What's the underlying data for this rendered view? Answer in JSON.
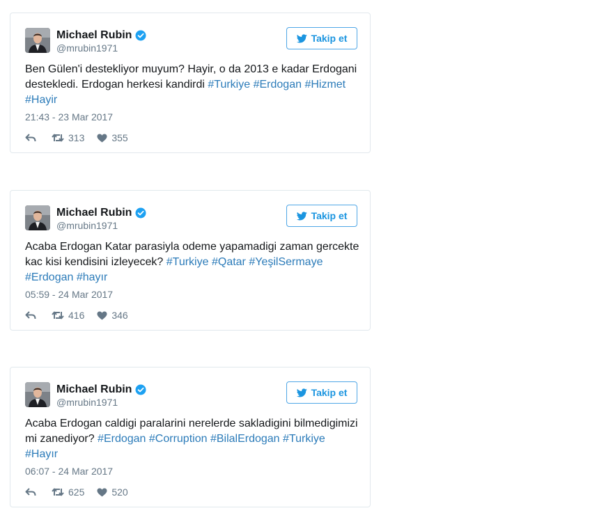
{
  "tweets": [
    {
      "author_name": "Michael Rubin",
      "author_handle": "@mrubin1971",
      "follow_label": "Takip et",
      "text_segments": [
        {
          "type": "text",
          "value": "Ben Gülen'i destekliyor muyum? Hayir, o da 2013 e kadar Erdogani destekledi. Erdogan herkesi kandirdi "
        },
        {
          "type": "hashtag",
          "value": "#Turkiye"
        },
        {
          "type": "text",
          "value": " "
        },
        {
          "type": "hashtag",
          "value": "#Erdogan"
        },
        {
          "type": "text",
          "value": " "
        },
        {
          "type": "hashtag",
          "value": "#Hizmet"
        },
        {
          "type": "text",
          "value": " "
        },
        {
          "type": "hashtag",
          "value": "#Hayir"
        }
      ],
      "timestamp": "21:43 - 23 Mar 2017",
      "retweets": "313",
      "likes": "355"
    },
    {
      "author_name": "Michael Rubin",
      "author_handle": "@mrubin1971",
      "follow_label": "Takip et",
      "text_segments": [
        {
          "type": "text",
          "value": "Acaba Erdogan Katar parasiyla odeme yapamadigi zaman gercekte kac kisi kendisini izleyecek? "
        },
        {
          "type": "hashtag",
          "value": "#Turkiye"
        },
        {
          "type": "text",
          "value": " "
        },
        {
          "type": "hashtag",
          "value": "#Qatar"
        },
        {
          "type": "text",
          "value": " "
        },
        {
          "type": "hashtag",
          "value": "#YeşilSermaye"
        },
        {
          "type": "text",
          "value": " "
        },
        {
          "type": "hashtag",
          "value": "#Erdogan"
        },
        {
          "type": "text",
          "value": " "
        },
        {
          "type": "hashtag",
          "value": "#hayır"
        }
      ],
      "timestamp": "05:59 - 24 Mar 2017",
      "retweets": "416",
      "likes": "346"
    },
    {
      "author_name": "Michael Rubin",
      "author_handle": "@mrubin1971",
      "follow_label": "Takip et",
      "text_segments": [
        {
          "type": "text",
          "value": "Acaba Erdogan caldigi paralarini nerelerde sakladigini bilmedigimizi mi zanediyor? "
        },
        {
          "type": "hashtag",
          "value": "#Erdogan"
        },
        {
          "type": "text",
          "value": " "
        },
        {
          "type": "hashtag",
          "value": "#Corruption"
        },
        {
          "type": "text",
          "value": " "
        },
        {
          "type": "hashtag",
          "value": "#BilalErdogan"
        },
        {
          "type": "text",
          "value": " "
        },
        {
          "type": "hashtag",
          "value": "#Turkiye"
        },
        {
          "type": "text",
          "value": " "
        },
        {
          "type": "hashtag",
          "value": "#Hayır"
        }
      ],
      "timestamp": "06:07 - 24 Mar 2017",
      "retweets": "625",
      "likes": "520"
    }
  ],
  "colors": {
    "hashtag": "#2b7bb9",
    "muted": "#657786",
    "follow_accent": "#1b95e0",
    "verified": "#1da1f2",
    "border": "#e1e8ed"
  },
  "icons": {
    "verified": "verified-badge-icon",
    "twitter": "twitter-bird-icon",
    "reply": "reply-icon",
    "retweet": "retweet-icon",
    "like": "heart-icon"
  }
}
